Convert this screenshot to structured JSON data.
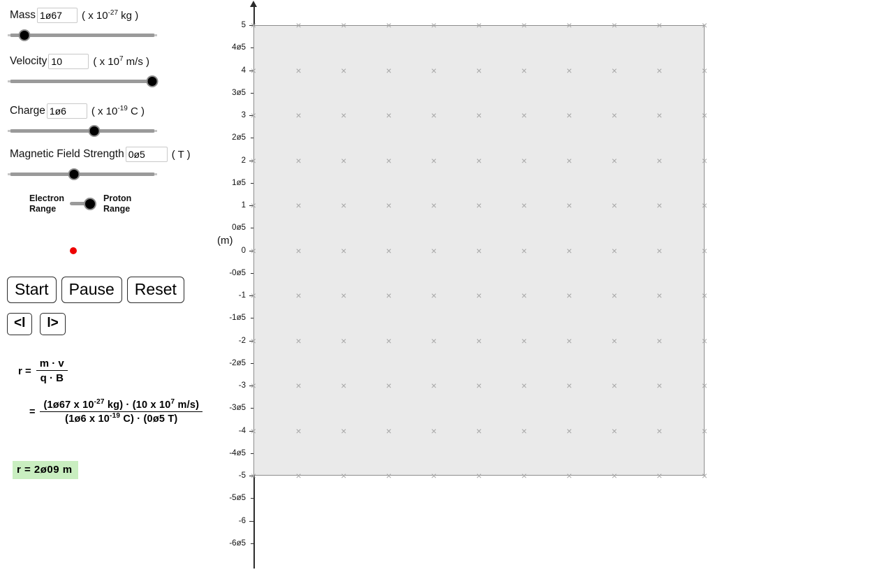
{
  "controls": {
    "mass": {
      "label": "Mass",
      "value": "1ø67",
      "units_prefix": "( x 10",
      "units_exp": "-27",
      "units_suffix": " kg )",
      "slider_percent": 10
    },
    "velocity": {
      "label": "Velocity",
      "value": "10",
      "units_prefix": "( x 10",
      "units_exp": "7",
      "units_suffix": " m/s )",
      "slider_percent": 98
    },
    "charge": {
      "label": "Charge",
      "value": "1ø6",
      "units_prefix": "( x 10",
      "units_exp": "-19",
      "units_suffix": " C )",
      "slider_percent": 58
    },
    "magnetic_field": {
      "label": "Magnetic Field Strength",
      "value": "0ø5",
      "units_prefix": "( ",
      "units_exp": "",
      "units_suffix": "T )",
      "slider_percent": 44
    }
  },
  "particle_toggle": {
    "left_label_line1": "Electron",
    "left_label_line2": "Range",
    "right_label_line1": "Proton",
    "right_label_line2": "Range",
    "selected": "Proton Range",
    "thumb_percent": 100,
    "particle_color": "#ee0000"
  },
  "buttons": {
    "start": "Start",
    "pause": "Pause",
    "reset": "Reset",
    "step_back": "<l",
    "step_forward": "l>"
  },
  "formula": {
    "lhs": "r  =",
    "symbolic_numerator": "m · v",
    "symbolic_denominator": "q · B",
    "equals": "=",
    "numeric_numerator_a": "(1ø67  x  10",
    "numeric_numerator_a_exp": "-27",
    "numeric_numerator_b": " kg) · (10  x  10",
    "numeric_numerator_b_exp": "7",
    "numeric_numerator_c": " m/s)",
    "numeric_denominator_a": "(1ø6  x  10",
    "numeric_denominator_a_exp": "-19",
    "numeric_denominator_b": " C) · (0ø5  T)",
    "result": "r  =  2ø09  m",
    "result_bg": "#c9eec0"
  },
  "graph": {
    "axis_unit_label": "(m)",
    "y_tick_labels": [
      "5",
      "4ø5",
      "4",
      "3ø5",
      "3",
      "2ø5",
      "2",
      "1ø5",
      "1",
      "0ø5",
      "0",
      "-0ø5",
      "-1",
      "-1ø5",
      "-2",
      "-2ø5",
      "-3",
      "-3ø5",
      "-4",
      "-4ø5",
      "-5",
      "-5ø5",
      "-6",
      "-6ø5"
    ],
    "y_tick_values": [
      5,
      4.5,
      4,
      3.5,
      3,
      2.5,
      2,
      1.5,
      1,
      0.5,
      0,
      -0.5,
      -1,
      -1.5,
      -2,
      -2.5,
      -3,
      -3.5,
      -4,
      -4.5,
      -5,
      -5.5,
      -6,
      -6.5
    ],
    "field_marker_glyph": "×",
    "field_marker_meaning": "magnetic-field-into-page",
    "field_marker_color": "#a6a6a6",
    "field_region_color": "#eaeaea",
    "field_rows": 11,
    "field_cols": 11,
    "field_x_min": 0,
    "field_x_max": 10,
    "field_y_min": -5,
    "field_y_max": 5
  }
}
